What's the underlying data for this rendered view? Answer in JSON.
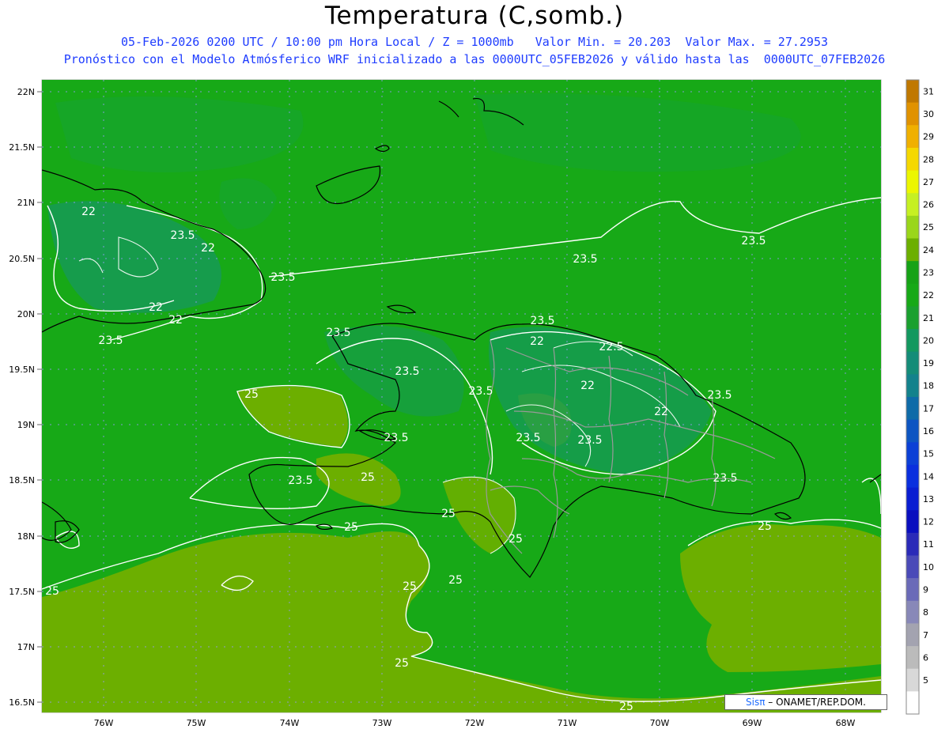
{
  "header": {
    "title": "Temperatura (C,somb.)",
    "subtitle_line1": "05-Feb-2026 0200 UTC / 10:00 pm Hora Local / Z = 1000mb   Valor Min. = 20.203  Valor Max. = 27.2953",
    "subtitle_line2": "Pronóstico con el Modelo Atmósferico WRF inicializado a las 0000UTC_05FEB2026 y válido hasta las  0000UTC_07FEB2026"
  },
  "map": {
    "lat_labels": [
      "22N",
      "21.5N",
      "21N",
      "20.5N",
      "20N",
      "19.5N",
      "19N",
      "18.5N",
      "18N",
      "17.5N",
      "17N",
      "16.5N"
    ],
    "lon_labels": [
      "76W",
      "75W",
      "74W",
      "73W",
      "72W",
      "71W",
      "70W",
      "69W",
      "68W"
    ],
    "contour_labels": [
      "22",
      "22",
      "22",
      "22",
      "22",
      "22",
      "22",
      "22.5",
      "23.5",
      "23.5",
      "23.5",
      "23.5",
      "23.5",
      "23.5",
      "23.5",
      "23.5",
      "23.5",
      "23.5",
      "23.5",
      "23.5",
      "23.5",
      "23.5",
      "23.5",
      "25",
      "25",
      "25",
      "25",
      "25",
      "25",
      "25",
      "25",
      "25",
      "25"
    ],
    "colors": {
      "ocean": "#17a917",
      "warm": "#6caf00",
      "cool": "#16995a"
    }
  },
  "colorbar": {
    "ticks": [
      "31",
      "30",
      "29",
      "28",
      "27",
      "26",
      "25",
      "24",
      "23",
      "22",
      "21",
      "20",
      "19",
      "18",
      "17",
      "16",
      "15",
      "14",
      "13",
      "12",
      "11",
      "10",
      "9",
      "8",
      "7",
      "6",
      "5"
    ],
    "colors": [
      "#c07800",
      "#e09200",
      "#f0b000",
      "#f5d800",
      "#ecf600",
      "#c6f022",
      "#9ad61a",
      "#6caf00",
      "#16a216",
      "#17a917",
      "#1aa02f",
      "#13985f",
      "#148c78",
      "#13828c",
      "#0e6ba8",
      "#0d55c2",
      "#0b40d6",
      "#0a2fde",
      "#0a1ed2",
      "#0a0fbf",
      "#2a2ab8",
      "#4a4ab8",
      "#6a6ab8",
      "#8888b8",
      "#a3a3b0",
      "#bbbbbb",
      "#d8d8d8",
      "#ffffff"
    ]
  },
  "credit": {
    "sis": "Sisπ",
    "rest": "– ONAMET/REP.DOM."
  }
}
